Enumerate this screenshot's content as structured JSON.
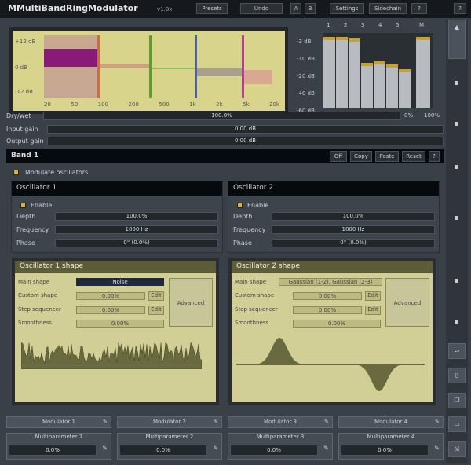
{
  "header": {
    "title": "MMultiBandRingModulator",
    "version": "v1.0x",
    "buttons": [
      "Presets",
      "Undo",
      "A",
      "B",
      "Settings",
      "Sidechain",
      "?"
    ]
  },
  "display": {
    "y_labels": [
      "+12 dB",
      "0 dB",
      "-12 dB"
    ],
    "x_labels": [
      "20",
      "50",
      "100",
      "200",
      "500",
      "1k",
      "2k",
      "5k",
      "20k"
    ],
    "band_colors": [
      "#8a1a7a",
      "#c87040",
      "#5aa030",
      "#5060a8",
      "#b04090"
    ]
  },
  "meter": {
    "channels": [
      "1",
      "2",
      "3",
      "4",
      "5",
      "M"
    ],
    "scale": [
      "-3 dB",
      "-10 dB",
      "-20 dB",
      "-40 dB",
      "-60 dB"
    ],
    "levels": [
      0.95,
      0.95,
      0.93,
      0.6,
      0.62,
      0.58,
      0.52,
      0.95
    ]
  },
  "params": {
    "drywet": {
      "label": "Dry/wet",
      "value": "100.0%",
      "extra": [
        "0%",
        "100%"
      ]
    },
    "input": {
      "label": "Input gain",
      "value": "0.00 dB"
    },
    "output": {
      "label": "Output gain",
      "value": "0.00 dB"
    }
  },
  "band": {
    "title": "Band 1",
    "buttons": [
      "Off",
      "Copy",
      "Paste",
      "Reset",
      "?"
    ],
    "modulate": "Modulate oscillators"
  },
  "osc": [
    {
      "title": "Oscillator 1",
      "enable": "Enable",
      "rows": [
        {
          "label": "Depth",
          "value": "100.0%"
        },
        {
          "label": "Frequency",
          "value": "1000 Hz"
        },
        {
          "label": "Phase",
          "value": "0° (0.0%)"
        }
      ]
    },
    {
      "title": "Oscillator 2",
      "enable": "Enable",
      "rows": [
        {
          "label": "Depth",
          "value": "100.0%"
        },
        {
          "label": "Frequency",
          "value": "1000 Hz"
        },
        {
          "label": "Phase",
          "value": "0° (0.0%)"
        }
      ]
    }
  ],
  "shapes": [
    {
      "title": "Oscillator 1 shape",
      "main_label": "Main shape",
      "main_value": "Noise",
      "rows": [
        {
          "label": "Custom shape",
          "value": "0.00%",
          "btn": "Edit"
        },
        {
          "label": "Step sequencer",
          "value": "0.00%",
          "btn": "Edit"
        },
        {
          "label": "Smoothness",
          "value": "0.00%"
        }
      ],
      "advanced": "Advanced"
    },
    {
      "title": "Oscillator 2 shape",
      "main_label": "Main shape",
      "main_value": "Gaussian (1-2), Gaussian (2-3)",
      "rows": [
        {
          "label": "Custom shape",
          "value": "0.00%",
          "btn": "Edit"
        },
        {
          "label": "Step sequencer",
          "value": "0.00%",
          "btn": "Edit"
        },
        {
          "label": "Smoothness",
          "value": "0.00%"
        }
      ],
      "advanced": "Advanced"
    }
  ],
  "modulators": [
    "Modulator 1",
    "Modulator 2",
    "Modulator 3",
    "Modulator 4"
  ],
  "multiparams": [
    {
      "label": "Multiparameter 1",
      "value": "0.0%"
    },
    {
      "label": "Multiparameter 2",
      "value": "0.0%"
    },
    {
      "label": "Multiparameter 3",
      "value": "0.0%"
    },
    {
      "label": "Multiparameter 4",
      "value": "0.0%"
    }
  ]
}
